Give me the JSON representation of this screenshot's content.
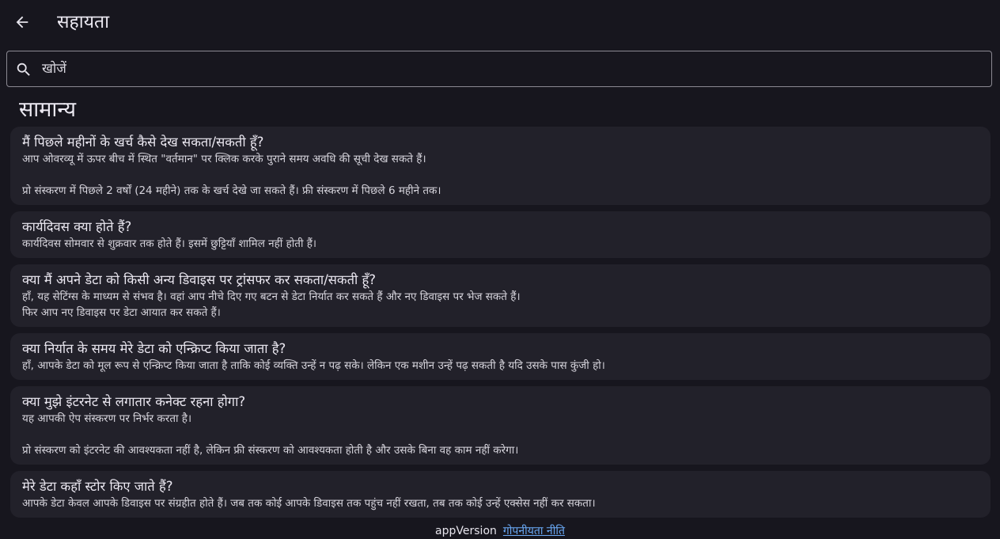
{
  "appbar": {
    "title": "सहायता",
    "back_icon": "arrow-back-icon"
  },
  "search": {
    "placeholder": "खोजें",
    "value": "",
    "icon": "search-icon"
  },
  "section": {
    "title": "सामान्य"
  },
  "faqs": [
    {
      "question": "मैं पिछले महीनों के खर्च कैसे देख सकता/सकती हूँ?",
      "answer": "आप ओवरव्यू में ऊपर बीच में स्थित \"वर्तमान\" पर क्लिक करके पुराने समय अवधि की सूची देख सकते हैं।\n\nप्रो संस्करण में पिछले 2 वर्षों (24 महीने) तक के खर्च देखे जा सकते हैं। फ्री संस्करण में पिछले 6 महीने तक।"
    },
    {
      "question": "कार्यदिवस क्या होते हैं?",
      "answer": "कार्यदिवस सोमवार से शुक्रवार तक होते हैं। इसमें छुट्टियाँ शामिल नहीं होती हैं।"
    },
    {
      "question": "क्या मैं अपने डेटा को किसी अन्य डिवाइस पर ट्रांसफर कर सकता/सकती हूँ?",
      "answer": "हाँ, यह सेटिंग्स के माध्यम से संभव है। वहां आप नीचे दिए गए बटन से डेटा निर्यात कर सकते हैं और नए डिवाइस पर भेज सकते हैं।\nफिर आप नए डिवाइस पर डेटा आयात कर सकते हैं।"
    },
    {
      "question": "क्या निर्यात के समय मेरे डेटा को एन्क्रिप्ट किया जाता है?",
      "answer": "हाँ, आपके डेटा को मूल रूप से एन्क्रिप्ट किया जाता है ताकि कोई व्यक्ति उन्हें न पढ़ सके। लेकिन एक मशीन उन्हें पढ़ सकती है यदि उसके पास कुंजी हो।"
    },
    {
      "question": "क्या मुझे इंटरनेट से लगातार कनेक्ट रहना होगा?",
      "answer": "यह आपकी ऐप संस्करण पर निर्भर करता है।\n\nप्रो संस्करण को इंटरनेट की आवश्यकता नहीं है, लेकिन फ्री संस्करण को आवश्यकता होती है और उसके बिना वह काम नहीं करेगा।"
    },
    {
      "question": "मेरे डेटा कहाँ स्टोर किए जाते हैं?",
      "answer": "आपके डेटा केवल आपके डिवाइस पर संग्रहीत होते हैं। जब तक कोई आपके डिवाइस तक पहुंच नहीं रखता, तब तक कोई उन्हें एक्सेस नहीं कर सकता।"
    }
  ],
  "footer": {
    "version_label": "appVersion",
    "privacy_link": "गोपनीयता नीति"
  },
  "colors": {
    "background": "#17161e",
    "card": "#22212a",
    "link": "#6aa9f5"
  }
}
